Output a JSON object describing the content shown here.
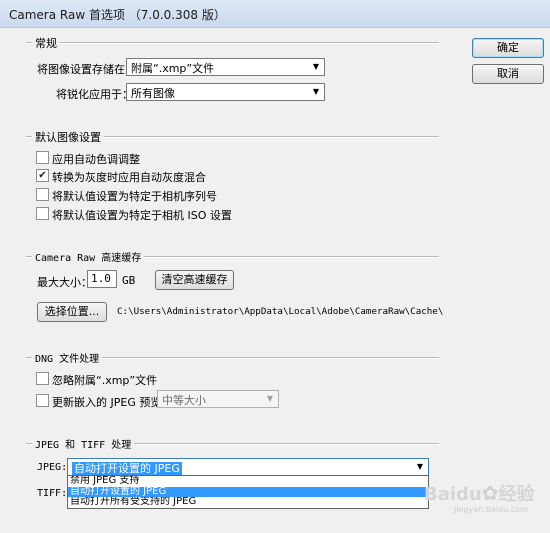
{
  "window": {
    "title": "Camera Raw 首选项 （7.0.0.308 版）"
  },
  "buttons": {
    "ok": "确定",
    "cancel": "取消"
  },
  "general": {
    "legend": "常规",
    "save_settings_label": "将图像设置存储在：",
    "save_settings_value": "附属“.xmp”文件",
    "sharpen_label": "将锐化应用于：",
    "sharpen_value": "所有图像"
  },
  "defaults": {
    "legend": "默认图像设置",
    "items": [
      {
        "label": "应用自动色调调整",
        "checked": false
      },
      {
        "label": "转换为灰度时应用自动灰度混合",
        "checked": true
      },
      {
        "label": "将默认值设置为特定于相机序列号",
        "checked": false
      },
      {
        "label": "将默认值设置为特定于相机 ISO 设置",
        "checked": false
      }
    ]
  },
  "cache": {
    "legend": "Camera Raw 高速缓存",
    "max_size_label": "最大大小：",
    "max_size_value": "1.0",
    "unit": "GB",
    "purge_button": "清空高速缓存",
    "select_location_button": "选择位置...",
    "path": "C:\\Users\\Administrator\\AppData\\Local\\Adobe\\CameraRaw\\Cache\\"
  },
  "dng": {
    "legend": "DNG 文件处理",
    "ignore_sidecar_label": "忽略附属“.xmp”文件",
    "ignore_sidecar_checked": false,
    "update_previews_label": "更新嵌入的 JPEG 预览：",
    "update_previews_checked": false,
    "preview_size_value": "中等大小"
  },
  "jpeg_tiff": {
    "legend": "JPEG 和 TIFF 处理",
    "jpeg_label": "JPEG:",
    "jpeg_value": "自动打开设置的 JPEG",
    "tiff_label": "TIFF:",
    "options": [
      {
        "label": "禁用 JPEG 支持",
        "selected": false
      },
      {
        "label": "自动打开设置的 JPEG",
        "selected": true
      },
      {
        "label": "自动打开所有受支持的 JPEG",
        "selected": false
      }
    ]
  },
  "watermark": {
    "brand": "Baidu",
    "chinese": "经验",
    "sub": "jingyan.baidu.com"
  },
  "icons": {
    "check": "check-icon",
    "dropdown": "chevron-down-icon",
    "paw": "paw-icon"
  },
  "colors": {
    "selection": "#3399ff",
    "titlebar": "#c9d9ee"
  }
}
